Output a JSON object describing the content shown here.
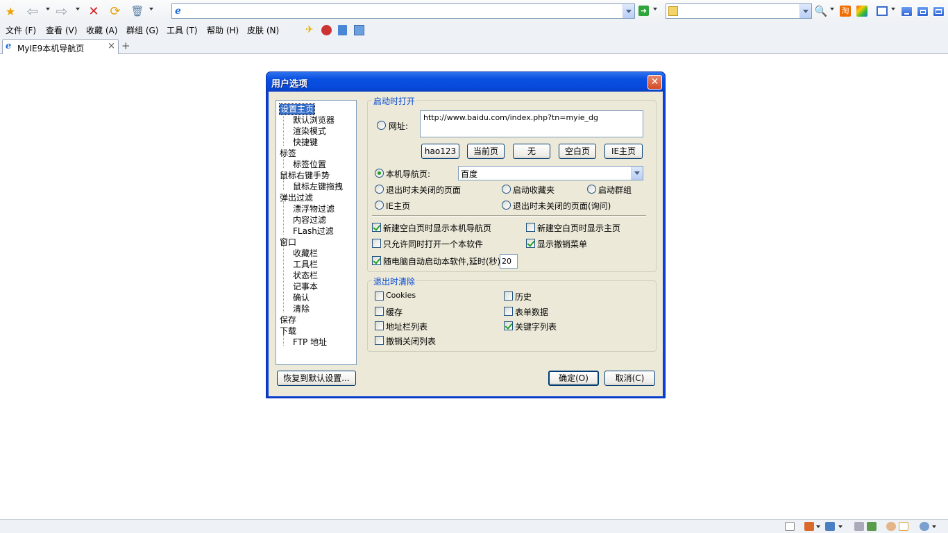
{
  "browser": {
    "address_value": "",
    "search_value": "",
    "menu": [
      {
        "label": "文件(F)",
        "display": "文件 (F)"
      },
      {
        "label": "查看(V)",
        "display": "查看 (V)"
      },
      {
        "label": "收藏(A)",
        "display": "收藏 (A)"
      },
      {
        "label": "群组(G)",
        "display": "群组 (G)"
      },
      {
        "label": "工具(T)",
        "display": "工具 (T)"
      },
      {
        "label": "帮助(H)",
        "display": "帮助 (H)"
      },
      {
        "label": "皮肤(N)",
        "display": "皮肤 (N)"
      }
    ],
    "tab": {
      "title": "MyIE9本机导航页",
      "close": "×"
    },
    "new_tab": "+"
  },
  "dialog": {
    "title": "用户选项",
    "close": "✕",
    "tree": {
      "n0": "设置主页",
      "n1": "默认浏览器",
      "n2": "渲染模式",
      "n3": "快捷键",
      "n4": "标签",
      "n5": "标签位置",
      "n6": "鼠标右键手势",
      "n7": "鼠标左键拖拽",
      "n8": "弹出过滤",
      "n9": "漂浮物过滤",
      "n10": "内容过滤",
      "n11": "FLash过滤",
      "n12": "窗口",
      "n13": "收藏栏",
      "n14": "工具栏",
      "n15": "状态栏",
      "n16": "记事本",
      "n17": "确认",
      "n18": "清除",
      "n19": "保存",
      "n20": "下载",
      "n21": "FTP 地址"
    },
    "startup": {
      "group_title": "启动时打开",
      "url_label": "网址:",
      "url_value": "http://www.baidu.com/index.php?tn=myie_dg",
      "btn_hao123": "hao123",
      "btn_current": "当前页",
      "btn_none": "无",
      "btn_blank": "空白页",
      "btn_ie": "IE主页",
      "nav_label": "本机导航页:",
      "nav_value": "百度",
      "opt_unclosed": "退出时未关闭的页面",
      "opt_favorites": "启动收藏夹",
      "opt_group": "启动群组",
      "opt_ie_home": "IE主页",
      "opt_unclosed_ask": "退出时未关闭的页面(询问)",
      "chk_blank_nav": "新建空白页时显示本机导航页",
      "chk_blank_home": "新建空白页时显示主页",
      "chk_single": "只允许同时打开一个本软件",
      "chk_undo_menu": "显示撤销菜单",
      "chk_autostart": "随电脑自动启动本软件,延时(秒)",
      "delay_value": "20"
    },
    "exit_clear": {
      "group_title": "退出时清除",
      "cookies": "Cookies",
      "history": "历史",
      "cache": "缓存",
      "form_data": "表单数据",
      "address_list": "地址栏列表",
      "keyword_list": "关键字列表",
      "undo_closed": "撤销关闭列表"
    },
    "btn_restore": "恢复到默认设置...",
    "btn_ok": "确定(O)",
    "btn_cancel": "取消(C)"
  }
}
